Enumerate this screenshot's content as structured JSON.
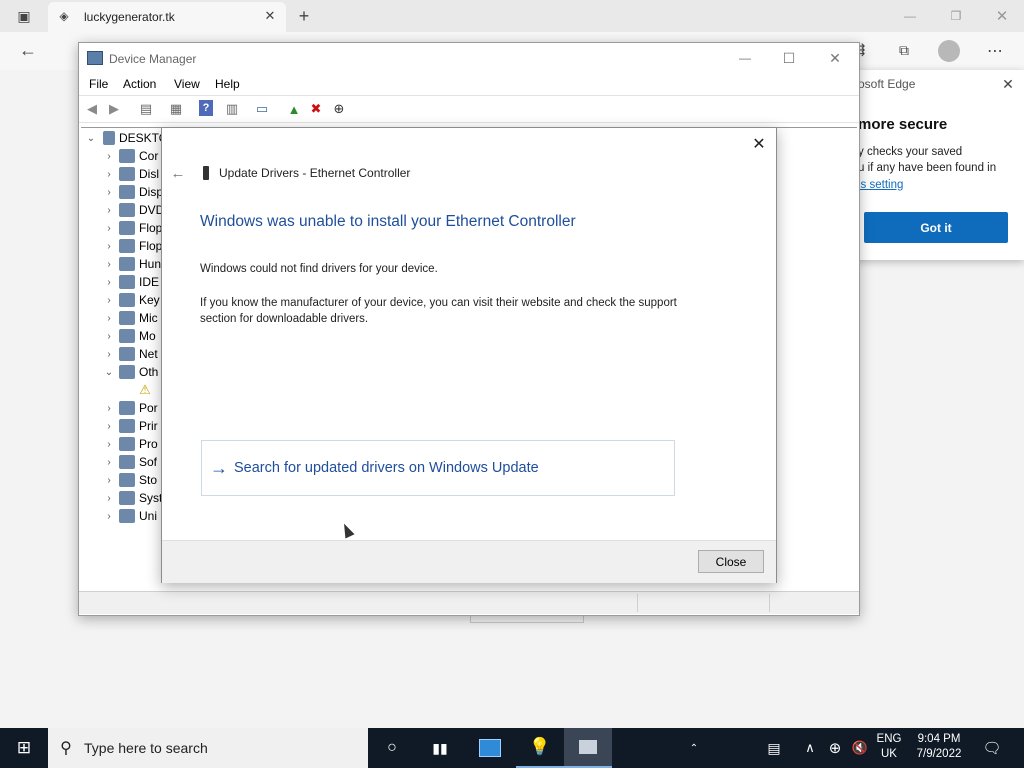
{
  "browser": {
    "tab_title": "luckygenerator.tk",
    "icons": [
      "tab-actions-icon",
      "page-icon",
      "close-icon",
      "new-tab-icon",
      "back-icon",
      "collections-icon",
      "profile-icon",
      "more-icon"
    ]
  },
  "edge_popup": {
    "title_fragment": "osoft Edge",
    "heading": "more secure",
    "line1": "y checks your saved",
    "line2": "u if any have been found in",
    "link": "is setting",
    "button": "Got it"
  },
  "device_manager": {
    "title": "Device Manager",
    "menu": [
      "File",
      "Action",
      "View",
      "Help"
    ],
    "tree": {
      "root": "DESKTO",
      "items": [
        "Cor",
        "Disl",
        "Disp",
        "DVD",
        "Flop",
        "Flop",
        "Hun",
        "IDE",
        "Key",
        "Mic",
        "Mo",
        "Net",
        "Oth",
        "",
        "Por",
        "Prir",
        "Pro",
        "Sof",
        "Sto",
        "Syst",
        "Uni"
      ]
    }
  },
  "update_dialog": {
    "header": "Update Drivers - Ethernet Controller",
    "heading": "Windows was unable to install your Ethernet Controller",
    "para1": "Windows could not find drivers for your device.",
    "para2a": "If you know the manufacturer of your device, you can visit their website and check the support",
    "para2b": "section for downloadable drivers.",
    "option": "Search for updated drivers on Windows Update",
    "close_button": "Close"
  },
  "taskbar": {
    "search_placeholder": "Type here to search",
    "lang1": "ENG",
    "lang2": "UK",
    "time": "9:04 PM",
    "date": "7/9/2022"
  },
  "colors": {
    "accent": "#0f6cbd",
    "heading_blue": "#1f4e9c",
    "taskbar": "#101a26"
  }
}
